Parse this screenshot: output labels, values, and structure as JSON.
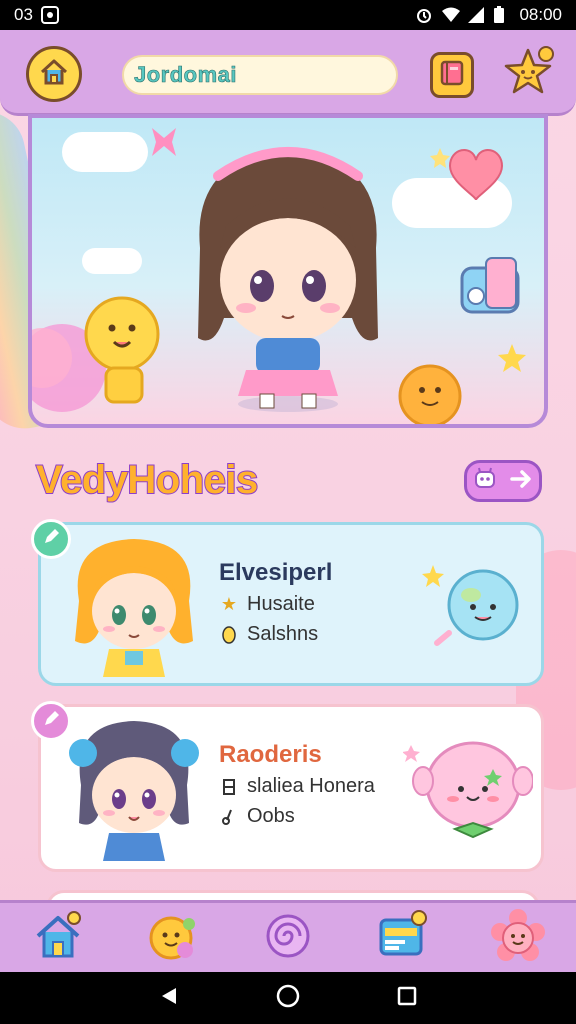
{
  "status_bar": {
    "left_text": "03",
    "time": "08:00"
  },
  "header": {
    "title": "Jordomai"
  },
  "section": {
    "title": "VedyHoheis"
  },
  "cards": [
    {
      "name": "Elvesiperl",
      "line1": "Husaite",
      "line2": "Salshns"
    },
    {
      "name": "Raoderis",
      "line1": "slaliea Honera",
      "line2": "Oobs"
    }
  ],
  "colors": {
    "header_bg": "#d9a7e6",
    "section_title_fill": "#ffb12d",
    "section_title_stroke": "#8d3fc9",
    "card1_bg": "#dff3fb",
    "card2_bg": "#ffffff"
  },
  "icons": {
    "header": [
      "home-icon",
      "book-icon",
      "star-face-icon"
    ],
    "bottom_nav": [
      "home-icon",
      "chat-bubble-icon",
      "spiral-icon",
      "card-icon",
      "flower-face-icon"
    ],
    "system_nav": [
      "back-icon",
      "home-circle-icon",
      "recents-icon"
    ]
  }
}
